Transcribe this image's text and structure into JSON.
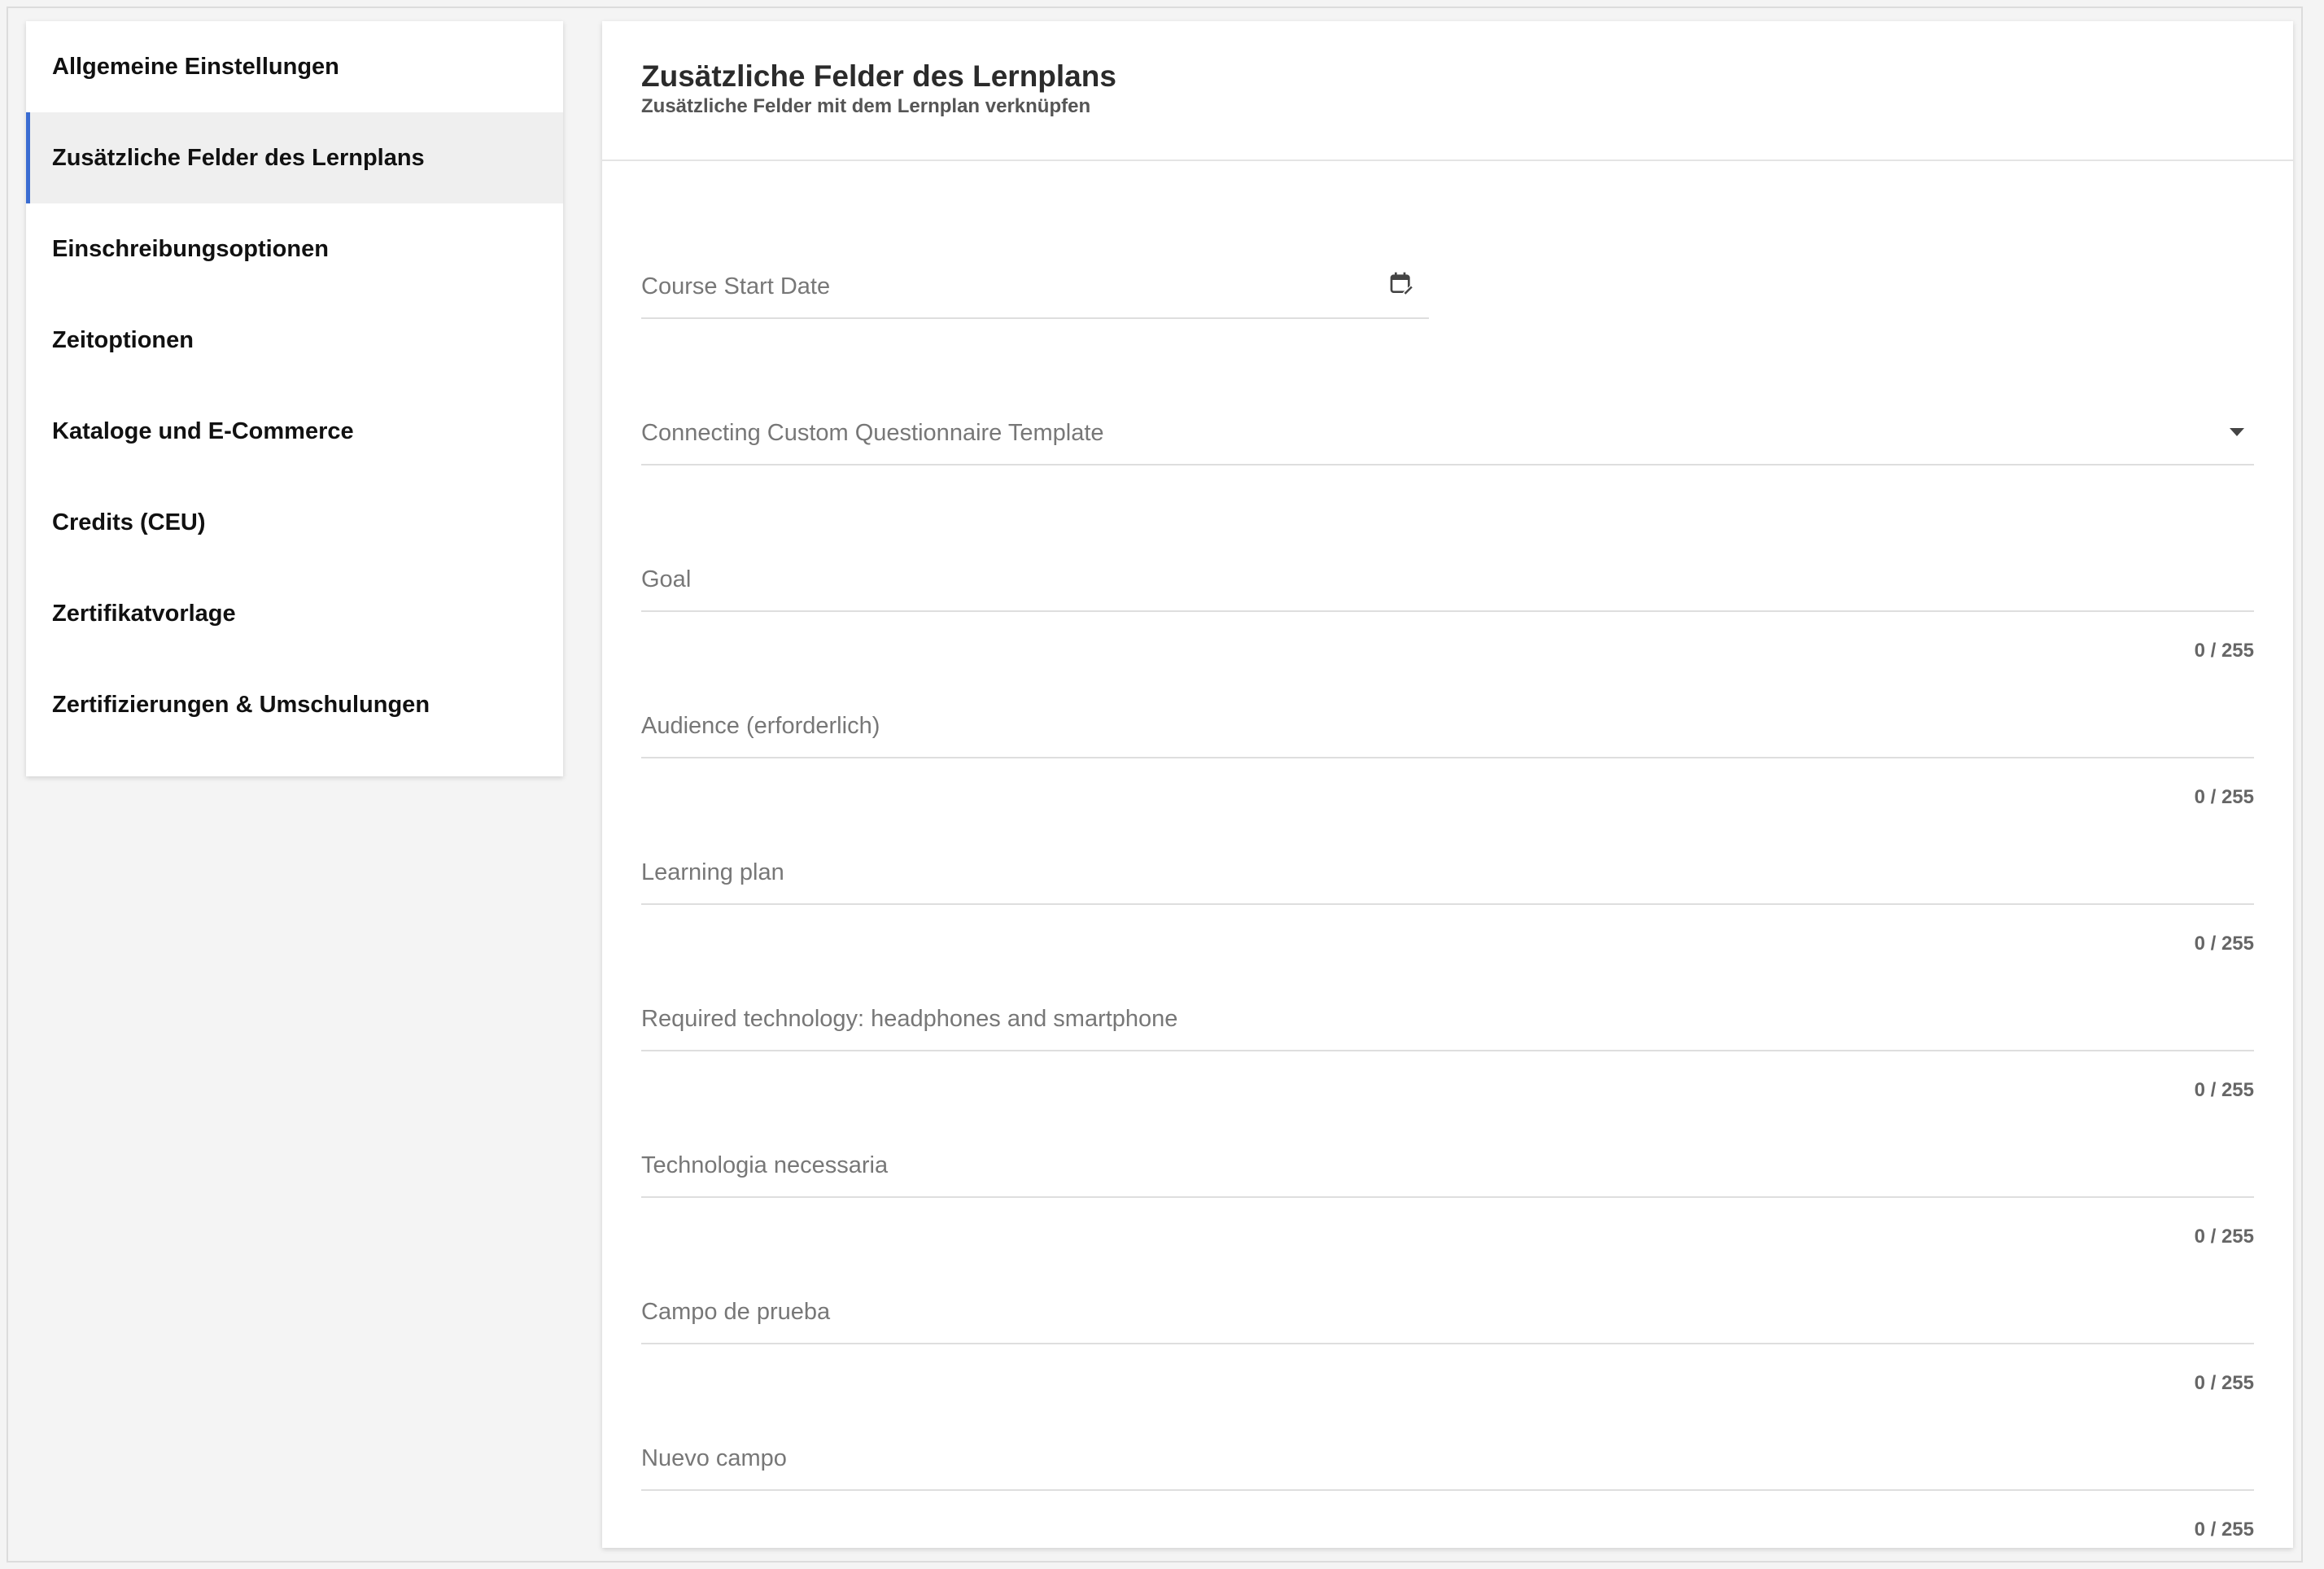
{
  "sidebar": {
    "items": [
      {
        "label": "Allgemeine Einstellungen"
      },
      {
        "label": "Zusätzliche Felder des Lernplans"
      },
      {
        "label": "Einschreibungsoptionen"
      },
      {
        "label": "Zeitoptionen"
      },
      {
        "label": "Kataloge und E-Commerce"
      },
      {
        "label": "Credits (CEU)"
      },
      {
        "label": "Zertifikatvorlage"
      },
      {
        "label": "Zertifizierungen & Umschulungen"
      }
    ],
    "active_index": 1,
    "active_color": "#3a6cd1"
  },
  "panel": {
    "title": "Zusätzliche Felder des Lernplans",
    "subtitle": "Zusätzliche Felder mit dem Lernplan verknüpfen"
  },
  "fields": {
    "course_start_date": {
      "label": "Course Start Date",
      "icon": "calendar-edit-icon"
    },
    "questionnaire": {
      "label": "Connecting Custom Questionnaire Template",
      "icon": "caret-down-icon"
    },
    "goal": {
      "label": "Goal",
      "counter": "0 / 255"
    },
    "audience": {
      "label": "Audience  (erforderlich)",
      "counter": "0 / 255"
    },
    "learning_plan": {
      "label": "Learning plan",
      "counter": "0 / 255"
    },
    "required_tech": {
      "label": "Required technology: headphones and smartphone",
      "counter": "0 / 255"
    },
    "tecnologia": {
      "label": "Technologia necessaria",
      "counter": "0 / 255"
    },
    "campo_prueba": {
      "label": "Campo de prueba",
      "counter": "0 / 255"
    },
    "nuevo_campo": {
      "label": "Nuevo campo",
      "counter": "0 / 255"
    }
  }
}
